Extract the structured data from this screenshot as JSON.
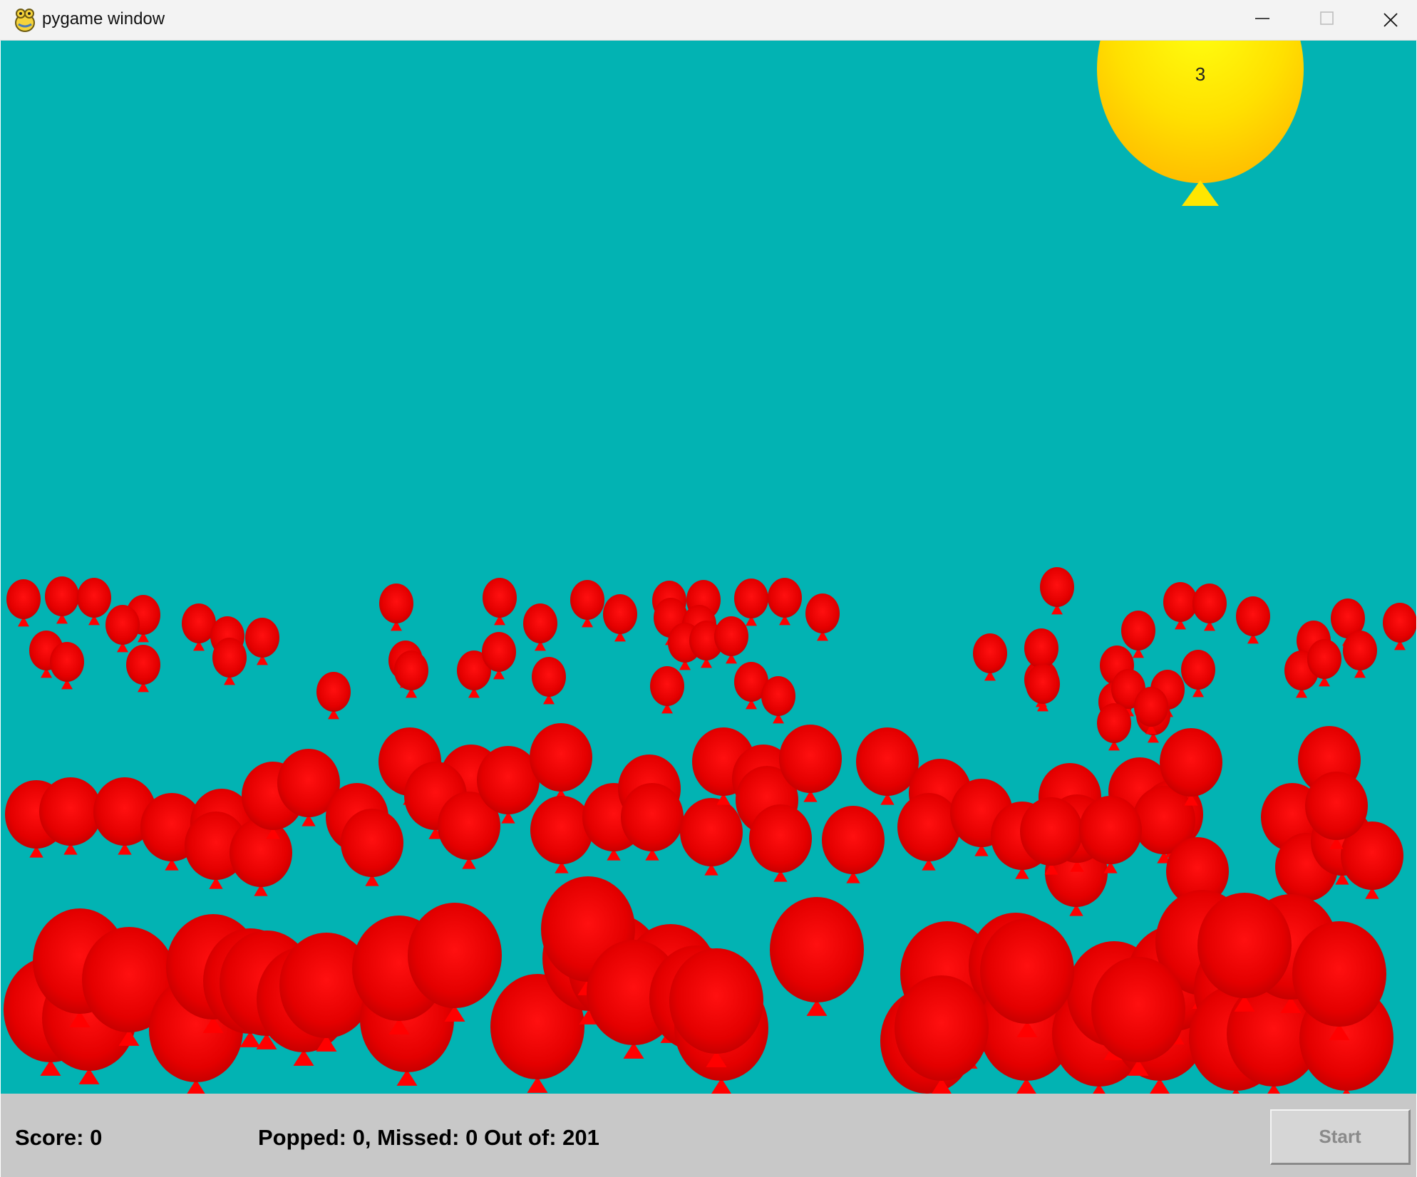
{
  "window": {
    "title": "pygame window",
    "icon": "pygame-snake-icon",
    "controls": [
      "minimize-icon",
      "maximize-icon",
      "close-icon"
    ]
  },
  "game": {
    "background_color": "#02b3b3",
    "special_balloon": {
      "label": "3",
      "color": "#ffd700"
    },
    "balloon_color": "#ff0000"
  },
  "status": {
    "score_text": "Score: 0",
    "popped_text": "Popped: 0, Missed: 0 Out of: 201",
    "start_label": "Start"
  }
}
